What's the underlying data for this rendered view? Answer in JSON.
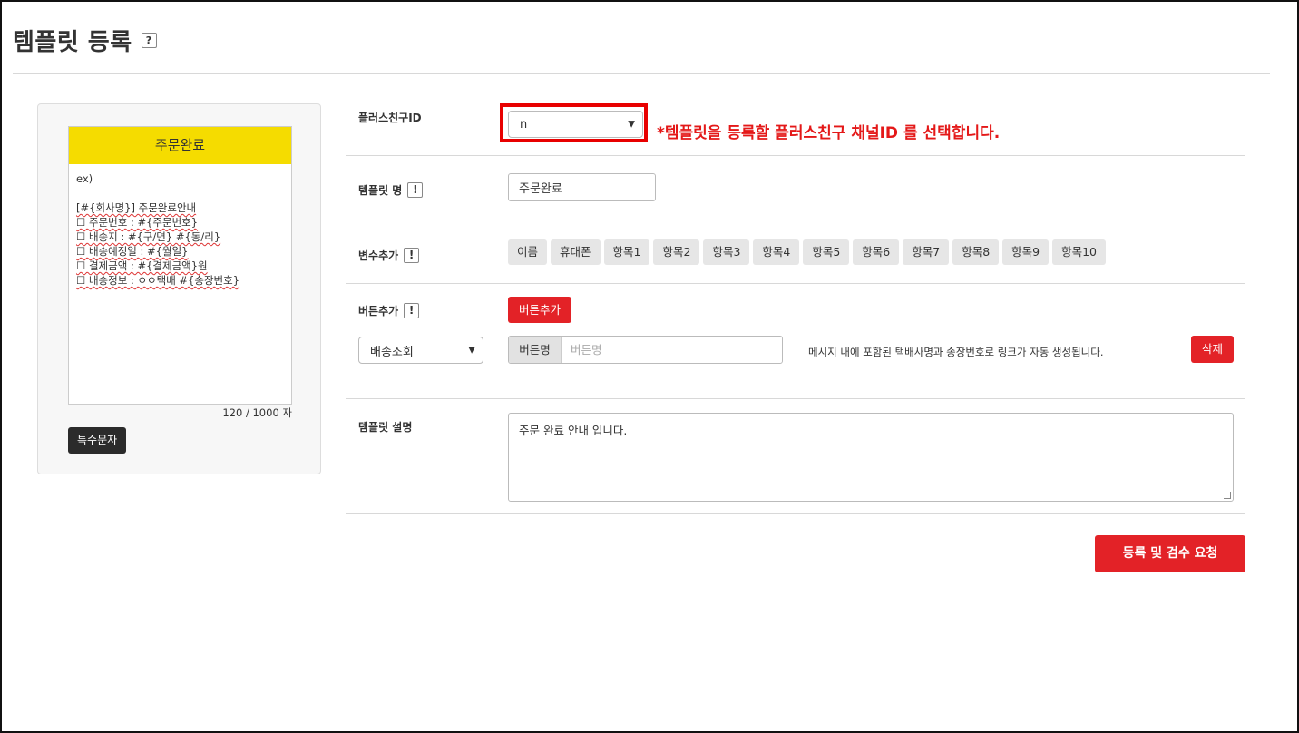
{
  "page": {
    "title": "템플릿 등록",
    "help_icon": "?"
  },
  "preview": {
    "header": "주문완료",
    "lines": [
      "ex)",
      "",
      "[#{회사명}] 주문완료안내",
      "☐ 주문번호 : #{주문번호}",
      "☐ 배송지 : #{구/면} #{동/리}",
      "☐ 배송예정일 : #{월일}",
      "☐ 결제금액 : #{결제금액}원",
      "☐ 배송정보 : ㅇㅇ택배  #{송장번호}"
    ],
    "char_count": "120 / 1000 자",
    "special_chars_button": "특수문자"
  },
  "form": {
    "channel": {
      "label": "플러스친구ID",
      "selected": "n",
      "note": "*템플릿을 등록할 플러스친구 채널ID 를 선택합니다."
    },
    "template_name": {
      "label": "템플릿 명",
      "value": "주문완료"
    },
    "variables": {
      "label": "변수추가",
      "buttons": [
        "이름",
        "휴대폰",
        "항목1",
        "항목2",
        "항목3",
        "항목4",
        "항목5",
        "항목6",
        "항목7",
        "항목8",
        "항목9",
        "항목10"
      ]
    },
    "buttons_section": {
      "label": "버튼추가",
      "add_button": "버튼추가",
      "type_selected": "배송조회",
      "name_addon": "버튼명",
      "name_placeholder": "버튼명",
      "link_note": "메시지 내에 포함된 택배사명과 송장번호로 링크가 자동 생성됩니다.",
      "delete_button": "삭제"
    },
    "description": {
      "label": "템플릿 설명",
      "value": "주문 완료 안내 입니다."
    },
    "submit_button": "등록 및 검수 요청",
    "info_icon": "!"
  },
  "colors": {
    "accent_red": "#e32227",
    "preview_header": "#f5dc00",
    "highlight_outline": "#e80000"
  }
}
